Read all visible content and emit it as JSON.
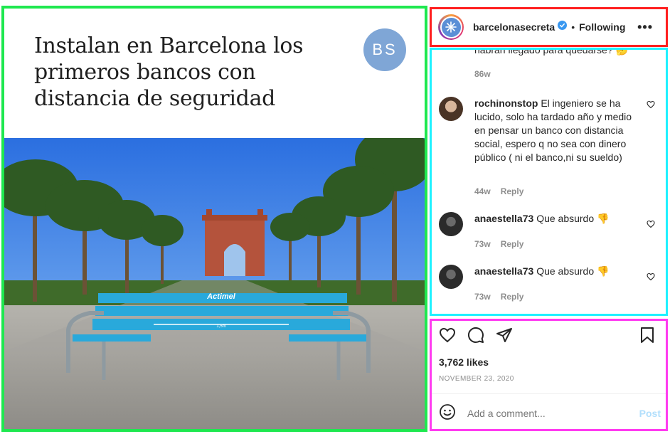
{
  "post": {
    "headline": "Instalan en Barcelona los primeros bancos con distancia de seguridad",
    "logo_text": "BS",
    "bench_brand": "Actimel",
    "bench_distance": "1,5m"
  },
  "header": {
    "username": "barcelonasecreta",
    "separator": "•",
    "follow_status": "Following",
    "more_label": "•••"
  },
  "comments": {
    "cut_text": "habrán llegado para quedarse?",
    "cut_time": "86w",
    "items": [
      {
        "username": "rochinonstop",
        "text": "El ingeniero se ha lucido, solo ha tardado año y medio en pensar un banco con distancia social, espero q no sea con dinero público ( ni el banco,ni su sueldo)",
        "time": "44w",
        "reply": "Reply"
      },
      {
        "username": "anaestella73",
        "text": "Que absurdo",
        "time": "73w",
        "reply": "Reply"
      },
      {
        "username": "anaestella73",
        "text": "Que absurdo",
        "time": "73w",
        "reply": "Reply"
      }
    ]
  },
  "actions": {
    "likes": "3,762 likes",
    "date": "NOVEMBER 23, 2020",
    "comment_placeholder": "Add a comment...",
    "post_label": "Post"
  },
  "colors": {
    "verified": "#3897f0",
    "link_disabled": "#b2dffc",
    "muted": "#8e8e8e"
  }
}
